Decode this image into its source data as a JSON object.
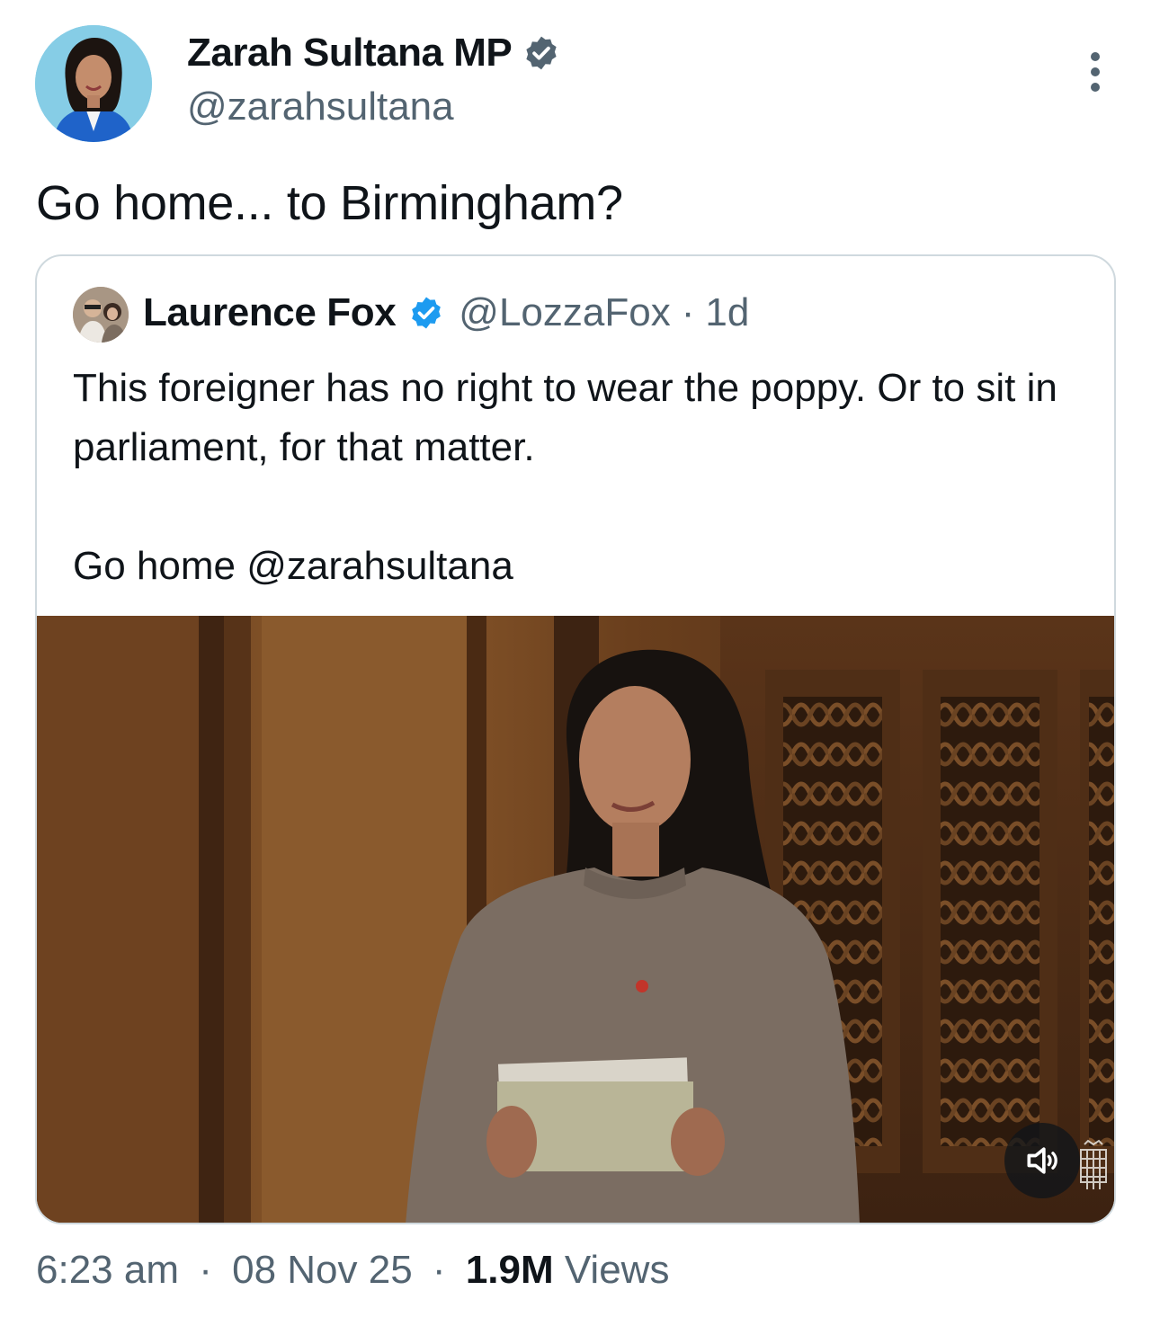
{
  "author": {
    "name": "Zarah Sultana MP",
    "handle": "@zarahsultana",
    "verified": true,
    "avatar_icon": "profile-photo"
  },
  "tweet": {
    "text": "Go home... to Birmingham?"
  },
  "quoted_tweet": {
    "name": "Laurence Fox",
    "handle": "@LozzaFox",
    "separator": "·",
    "time": "1d",
    "verified": true,
    "text_line1": "This foreigner has no right to wear the poppy. Or to sit in parliament, for that matter.",
    "text_line2": "Go home @zarahsultana",
    "media": {
      "type": "video",
      "mute_icon": "speaker-muted-icon",
      "watermark_icon": "portcullis-logo"
    }
  },
  "meta": {
    "time": "6:23 am",
    "date": "08 Nov 25",
    "sep": "·",
    "views_count": "1.9M",
    "views_label": "Views"
  },
  "colors": {
    "text": "#0f1419",
    "muted": "#536471",
    "verified_blue": "#1d9bf0",
    "border": "#cfd9de"
  }
}
